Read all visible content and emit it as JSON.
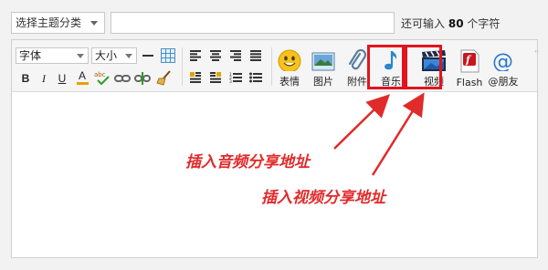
{
  "topic_select": {
    "value": "选择主题分类"
  },
  "title_input": {
    "value": ""
  },
  "char_hint": {
    "prefix": "还可输入",
    "count": "80",
    "suffix": "个字符"
  },
  "toolbar": {
    "font_family": "字体",
    "font_size": "大小",
    "bold": "B",
    "italic": "I",
    "underline": "U",
    "font_color": "A",
    "buttons": [
      {
        "name": "emoticon",
        "label": "表情",
        "icon": "smiley-icon"
      },
      {
        "name": "image",
        "label": "图片",
        "icon": "picture-icon"
      },
      {
        "name": "attachment",
        "label": "附件",
        "icon": "paperclip-icon"
      },
      {
        "name": "music",
        "label": "音乐",
        "icon": "music-note-icon"
      },
      {
        "name": "video",
        "label": "视频",
        "icon": "clapperboard-icon"
      },
      {
        "name": "flash",
        "label": "Flash",
        "icon": "flash-icon"
      },
      {
        "name": "mention",
        "label": "@朋友",
        "icon": "at-icon"
      }
    ]
  },
  "annotations": {
    "audio": "插入音频分享地址",
    "video": "插入视频分享地址",
    "highlight_color": "#e2141e"
  }
}
